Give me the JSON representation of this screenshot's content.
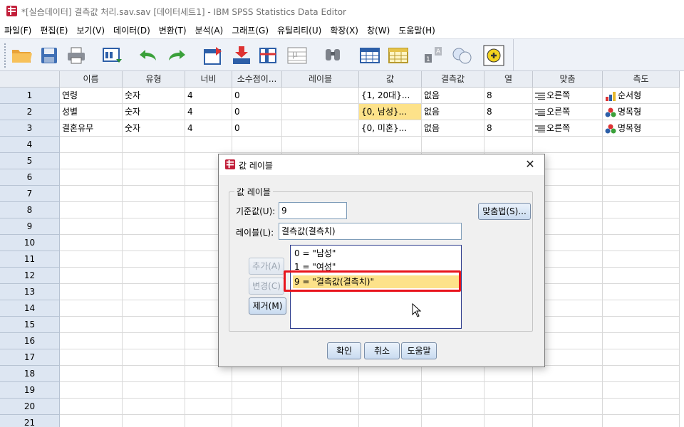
{
  "window": {
    "title": "*[실습데이터] 결측값 처리.sav.sav [데이터세트1] - IBM SPSS Statistics Data Editor"
  },
  "menu": [
    {
      "label": "파일(F)"
    },
    {
      "label": "편집(E)"
    },
    {
      "label": "보기(V)"
    },
    {
      "label": "데이터(D)"
    },
    {
      "label": "변환(T)"
    },
    {
      "label": "분석(A)"
    },
    {
      "label": "그래프(G)"
    },
    {
      "label": "유틸리티(U)"
    },
    {
      "label": "확장(X)"
    },
    {
      "label": "창(W)"
    },
    {
      "label": "도움말(H)"
    }
  ],
  "toolbar": {
    "icons": [
      "open-folder-icon",
      "save-icon",
      "print-icon",
      "dialog-recall-icon",
      "undo-icon",
      "redo-icon",
      "goto-case-icon",
      "insert-cases-icon",
      "insert-variable-icon",
      "split-file-icon",
      "find-binoculars-icon",
      "table-icon",
      "select-cases-icon",
      "weight-cases-icon",
      "value-labels-icon",
      "use-variable-sets-icon"
    ]
  },
  "grid": {
    "columns": [
      "",
      "이름",
      "유형",
      "너비",
      "소수점이...",
      "레이블",
      "값",
      "결측값",
      "열",
      "맞춤",
      "측도"
    ],
    "rows": [
      {
        "num": "1",
        "name": "연령",
        "type": "숫자",
        "width": "4",
        "decimals": "0",
        "label": "",
        "values": "{1, 20대}...",
        "missing": "없음",
        "cols": "8",
        "align": "오른쪽",
        "measure": "순서형",
        "measure_icon": "ordinal-bar-icon",
        "align_icon": "align-right-icon"
      },
      {
        "num": "2",
        "name": "성별",
        "type": "숫자",
        "width": "4",
        "decimals": "0",
        "label": "",
        "values": "{0, 남성}...",
        "missing": "없음",
        "cols": "8",
        "align": "오른쪽",
        "measure": "명목형",
        "measure_icon": "nominal-balls-icon",
        "align_icon": "align-right-icon"
      },
      {
        "num": "3",
        "name": "결혼유무",
        "type": "숫자",
        "width": "4",
        "decimals": "0",
        "label": "",
        "values": "{0, 미혼}...",
        "missing": "없음",
        "cols": "8",
        "align": "오른쪽",
        "measure": "명목형",
        "measure_icon": "nominal-balls-icon",
        "align_icon": "align-right-icon"
      }
    ],
    "empty_row_numbers": [
      "4",
      "5",
      "6",
      "7",
      "8",
      "9",
      "10",
      "11",
      "12",
      "13",
      "14",
      "15",
      "16",
      "17",
      "18",
      "19",
      "20",
      "21"
    ],
    "highlight_color": "#fde28a"
  },
  "dialog": {
    "title": "값 레이블",
    "group_label": "값 레이블",
    "value_label": "기준값(U):",
    "value_input": "9",
    "label_label": "레이블(L):",
    "label_input": "결측값(결측치)",
    "spelling_button": "맞춤법(S)...",
    "add_button": "추가(A)",
    "change_button": "변경(C)",
    "remove_button": "제거(M)",
    "list": [
      {
        "text": "0 = \"남성\"",
        "selected": false
      },
      {
        "text": "1 = \"여성\"",
        "selected": false
      },
      {
        "text": "9 = \"결측값(결측치)\"",
        "selected": true
      }
    ],
    "ok_button": "확인",
    "cancel_button": "취소",
    "help_button": "도움말",
    "highlight_border_color": "#e8141c"
  }
}
